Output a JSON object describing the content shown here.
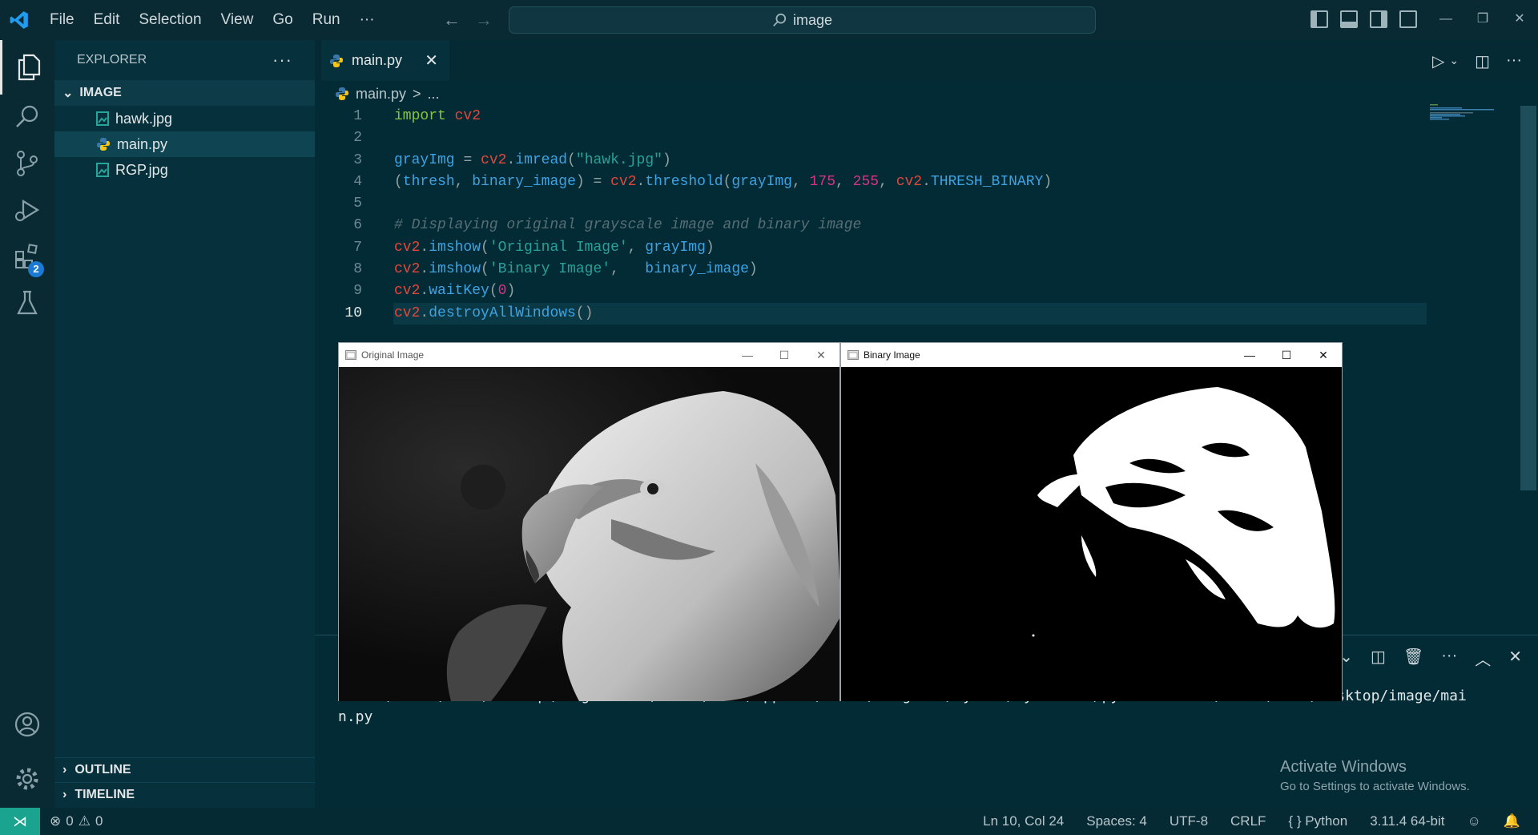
{
  "menu": [
    "File",
    "Edit",
    "Selection",
    "View",
    "Go",
    "Run",
    "···"
  ],
  "search": {
    "text": "image"
  },
  "explorer": {
    "title": "EXPLORER",
    "more": "···",
    "folder": "IMAGE",
    "files": [
      "hawk.jpg",
      "main.py",
      "RGP.jpg"
    ],
    "outline": "OUTLINE",
    "timeline": "TIMELINE"
  },
  "extensions_badge": "2",
  "tab": {
    "label": "main.py"
  },
  "breadcrumb": {
    "file": "main.py",
    "sep": ">",
    "rest": "..."
  },
  "code_lines": [
    "import cv2",
    "",
    "grayImg = cv2.imread(\"hawk.jpg\")",
    "(thresh, binary_image) = cv2.threshold(grayImg, 175, 255, cv2.THRESH_BINARY)",
    "",
    "# Displaying original grayscale image and binary image",
    "cv2.imshow('Original Image', grayImg)",
    "cv2.imshow('Binary Image',   binary_image)",
    "cv2.waitKey(0)",
    "cv2.destroyAllWindows()"
  ],
  "line_numbers": [
    "1",
    "2",
    "3",
    "4",
    "5",
    "6",
    "7",
    "8",
    "9",
    "10"
  ],
  "terminal": {
    "line1": "PS C:\\Users\\Lebs\\Desktop\\image> & C:/Users/Lebs/AppData/Local/Programs/Python/Python311/python.exe c:/Users/Lebs/Desktop/image/mai",
    "line2": "n.py"
  },
  "cv_windows": {
    "original": {
      "title": "Original Image"
    },
    "binary": {
      "title": "Binary Image"
    }
  },
  "watermark": {
    "line1": "Activate Windows",
    "line2": "Go to Settings to activate Windows."
  },
  "status": {
    "errors": "0",
    "warnings": "0",
    "position": "Ln 10, Col 24",
    "spaces": "Spaces: 4",
    "encoding": "UTF-8",
    "eol": "CRLF",
    "language": "Python",
    "interpreter": "3.11.4 64-bit"
  },
  "colors": {
    "activity_bg": "#0a2a33",
    "sidebar_bg": "#05303c",
    "editor_bg": "#022b36",
    "accent": "#1aa38f",
    "badge": "#1a7ad4"
  }
}
